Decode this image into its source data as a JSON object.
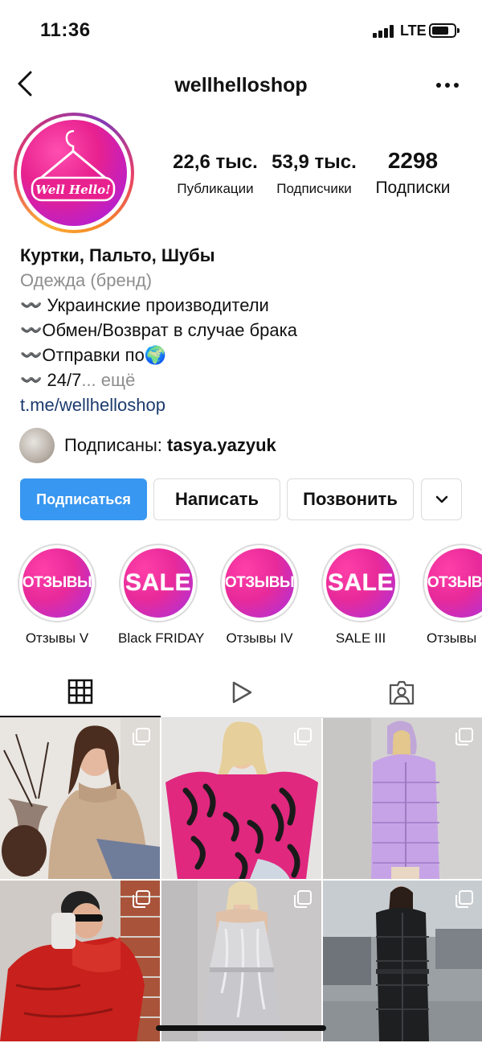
{
  "status_bar": {
    "time": "11:36",
    "network": "LTE"
  },
  "nav": {
    "username": "wellhelloshop"
  },
  "profile": {
    "avatar_text": "Well Hello!",
    "stats": [
      {
        "value": "22,6 тыс.",
        "label": "Публикации"
      },
      {
        "value": "53,9 тыс.",
        "label": "Подписчики"
      },
      {
        "value": "2298",
        "label": "Подписки"
      }
    ]
  },
  "bio": {
    "name": "Куртки, Пальто, Шубы",
    "category": "Одежда (бренд)",
    "lines": [
      "〰️ Украинские производители",
      "〰️Обмен/Возврат в случае брака",
      "〰️Отправки по🌍",
      "〰️ 24/7"
    ],
    "more": "... ещё",
    "link": "t.me/wellhelloshop"
  },
  "followed_by": {
    "prefix": "Подписаны: ",
    "user": "tasya.yazyuk"
  },
  "buttons": {
    "follow": "Подписаться",
    "message": "Написать",
    "call": "Позвонить"
  },
  "highlights": [
    {
      "cover": "ОТЗЫВЫ",
      "label": "Отзывы V"
    },
    {
      "cover": "SALE",
      "label": "Black FRIDAY"
    },
    {
      "cover": "ОТЗЫВЫ",
      "label": "Отзывы IV"
    },
    {
      "cover": "SALE",
      "label": "SALE III"
    },
    {
      "cover": "ОТЗЫВЫ",
      "label": "Отзывы"
    }
  ],
  "tabs": [
    "grid-icon",
    "reels-icon",
    "tagged-icon"
  ],
  "posts": [
    {
      "type": "carousel",
      "subject": "beige turtleneck sweater"
    },
    {
      "type": "carousel",
      "subject": "pink zebra sweater"
    },
    {
      "type": "carousel",
      "subject": "lilac puffer coat"
    },
    {
      "type": "carousel",
      "subject": "red puffer jacket"
    },
    {
      "type": "carousel",
      "subject": "silver slip dress"
    },
    {
      "type": "carousel",
      "subject": "black long puffer coat"
    }
  ],
  "colors": {
    "accent": "#3897f0",
    "link": "#1c3a6e",
    "secondary_text": "#8e8e8e",
    "highlight_pink": "#e82a9a"
  }
}
